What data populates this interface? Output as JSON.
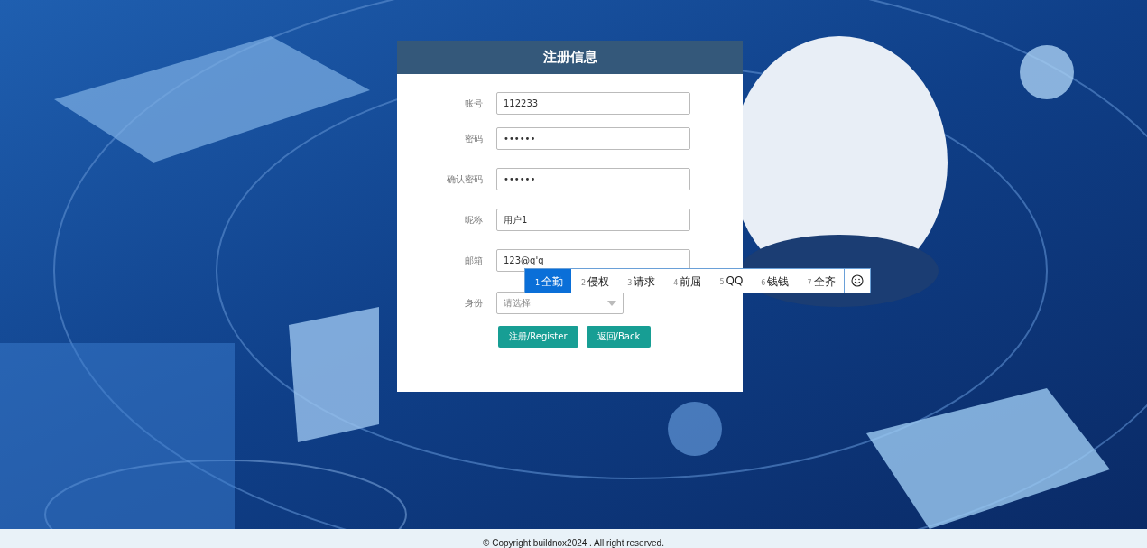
{
  "form": {
    "title": "注册信息",
    "fields": [
      {
        "kind": "text",
        "label": "账号",
        "value": "112233"
      },
      {
        "kind": "text",
        "label": "密码",
        "value": "••••••"
      },
      {
        "kind": "text",
        "label": "确认密码",
        "value": "••••••"
      },
      {
        "kind": "text",
        "label": "昵称",
        "value": "用户1"
      },
      {
        "kind": "text",
        "label": "邮箱",
        "value": "123@q'q"
      },
      {
        "kind": "select",
        "label": "身份",
        "placeholder": "请选择"
      }
    ],
    "buttons": [
      "注册/Register",
      "返回/Back"
    ]
  },
  "ime": {
    "candidates": [
      {
        "index": "1",
        "text": "全勤",
        "selected": true
      },
      {
        "index": "2",
        "text": "侵权",
        "selected": false
      },
      {
        "index": "3",
        "text": "请求",
        "selected": false
      },
      {
        "index": "4",
        "text": "前屈",
        "selected": false
      },
      {
        "index": "5",
        "text": "QQ",
        "selected": false
      },
      {
        "index": "6",
        "text": "钱钱",
        "selected": false
      },
      {
        "index": "7",
        "text": "全齐",
        "selected": false
      }
    ]
  },
  "footer": "© Copyright buildnox2024 . All right reserved."
}
